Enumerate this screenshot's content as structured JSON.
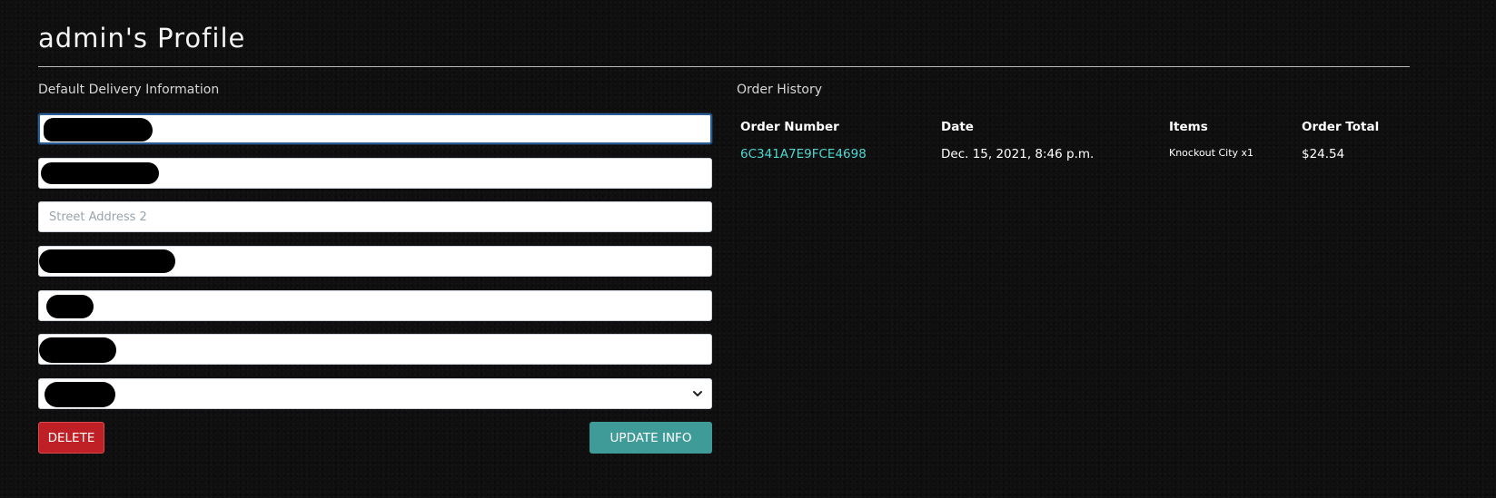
{
  "page": {
    "title": "admin's Profile"
  },
  "delivery": {
    "heading": "Default Delivery Information",
    "fields": [
      {
        "value": "",
        "placeholder": "",
        "redacted": true
      },
      {
        "value": "",
        "placeholder": "",
        "redacted": true
      },
      {
        "value": "",
        "placeholder": "Street Address 2",
        "redacted": false
      },
      {
        "value": "",
        "placeholder": "",
        "redacted": true
      },
      {
        "value": "",
        "placeholder": "",
        "redacted": true
      },
      {
        "value": "",
        "placeholder": "",
        "redacted": true
      }
    ],
    "country_select": {
      "selected": "",
      "redacted": true
    },
    "delete_label": "Delete",
    "update_label": "Update Info"
  },
  "order_history": {
    "heading": "Order History",
    "columns": [
      "Order Number",
      "Date",
      "Items",
      "Order Total"
    ],
    "rows": [
      {
        "order_number": "6C341A7E9FCE4698",
        "date": "Dec. 15, 2021, 8:46 p.m.",
        "items": "Knockout City x1",
        "total": "$24.54"
      }
    ]
  },
  "colors": {
    "background": "#0f0f0f",
    "delete_button": "#be2026",
    "update_button": "#3f9b97",
    "order_link": "#4ed8d0",
    "focus_border": "#2a5d96"
  },
  "icons": {
    "select_arrow": "chevron-down-icon"
  }
}
